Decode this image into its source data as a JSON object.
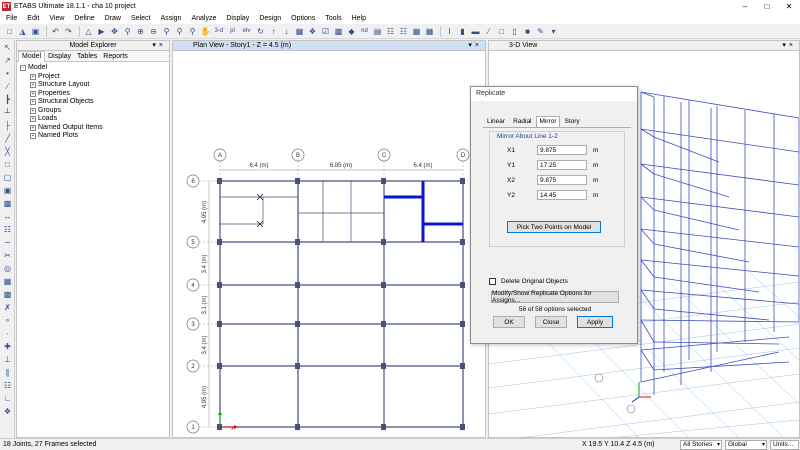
{
  "window": {
    "app_icon": "ET",
    "title": "ETABS Ultimate 18.1.1 - cha 10 project"
  },
  "menu": [
    "File",
    "Edit",
    "View",
    "Define",
    "Draw",
    "Select",
    "Assign",
    "Analyze",
    "Display",
    "Design",
    "Options",
    "Tools",
    "Help"
  ],
  "toolbar": {
    "text_3d": "3-d",
    "text_pl": "pl",
    "text_elv": "elv",
    "text_nd": "nd"
  },
  "model_explorer": {
    "title": "Model Explorer",
    "tabs": [
      "Model",
      "Display",
      "Tables",
      "Reports"
    ],
    "active_tab": "Model",
    "root": "Model",
    "items": [
      "Project",
      "Structure Layout",
      "Properties",
      "Structural Objects",
      "Groups",
      "Loads",
      "Named Output Items",
      "Named Plots"
    ]
  },
  "plan_view": {
    "title": "Plan View - Story1 - Z = 4.5 (m)",
    "grid_letters": [
      "A",
      "B",
      "C",
      "D"
    ],
    "grid_numbers": [
      "6",
      "5",
      "4",
      "3",
      "2",
      "1"
    ],
    "x_spacings": [
      "6.4 (m)",
      "6.85 (m)",
      "6.4 (m)"
    ],
    "y_spacings": [
      "4.95 (m)",
      "3.4 (m)",
      "3.1 (m)",
      "3.4 (m)",
      "4.95 (m)"
    ]
  },
  "view_3d": {
    "title": "3-D View"
  },
  "dialog": {
    "title": "Replicate",
    "tabs": [
      "Linear",
      "Radial",
      "Mirror",
      "Story"
    ],
    "active_tab": "Mirror",
    "group_label": "Mirror About Line 1-2",
    "fields": [
      {
        "label": "X1",
        "value": "9.875",
        "unit": "m"
      },
      {
        "label": "Y1",
        "value": "17.25",
        "unit": "m"
      },
      {
        "label": "X2",
        "value": "9.875",
        "unit": "m"
      },
      {
        "label": "Y2",
        "value": "14.45",
        "unit": "m"
      }
    ],
    "pick_button": "Pick Two Points on Model",
    "delete_original": "Delete Original Objects",
    "modify_button": "Modify/Show Replicate Options for Assigns...",
    "options_info": "56 of 58 options selected",
    "ok": "OK",
    "close": "Close",
    "apply": "Apply"
  },
  "status": {
    "selection": "18 Joints, 27 Frames selected",
    "coords": "X 19.5  Y 10.4  Z 4.5 (m)",
    "stories": "All Stories",
    "coord_system": "Global",
    "units": "Units..."
  },
  "colors": {
    "frame": "#48507e",
    "selected": "#0a14d8",
    "grid": "#6e6e6e",
    "accent": "#0078d7"
  }
}
